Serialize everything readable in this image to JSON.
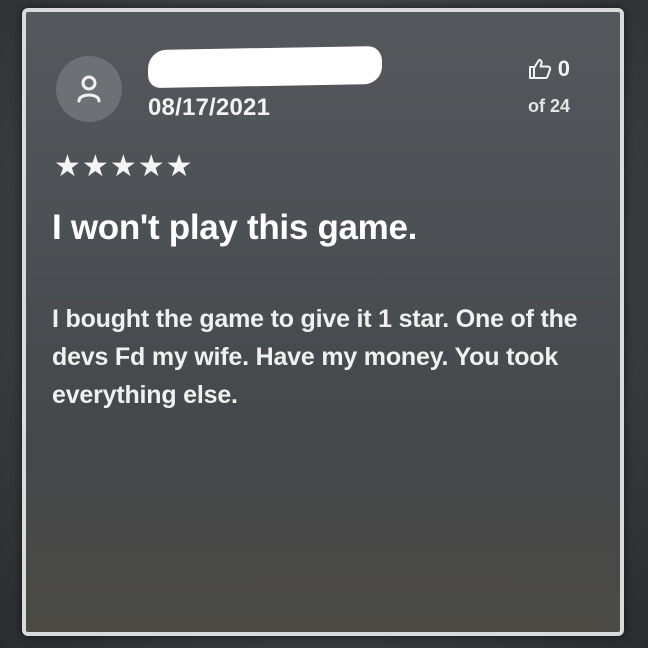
{
  "review": {
    "date": "08/17/2021",
    "rating": 5,
    "rating_max": 5,
    "title": "I won't play this game.",
    "body": "I bought the game to give it 1 star. One of the devs Fd my wife. Have my money. You took everything else."
  },
  "helpful": {
    "icon": "thumbs-up-icon",
    "count": "0",
    "total": "of 24"
  },
  "avatar": {
    "icon": "user-icon"
  },
  "stars": {
    "glyph": "★",
    "color": "#f4f4f4"
  },
  "colors": {
    "card_border": "#d9dadb",
    "redaction": "#ffffff"
  }
}
